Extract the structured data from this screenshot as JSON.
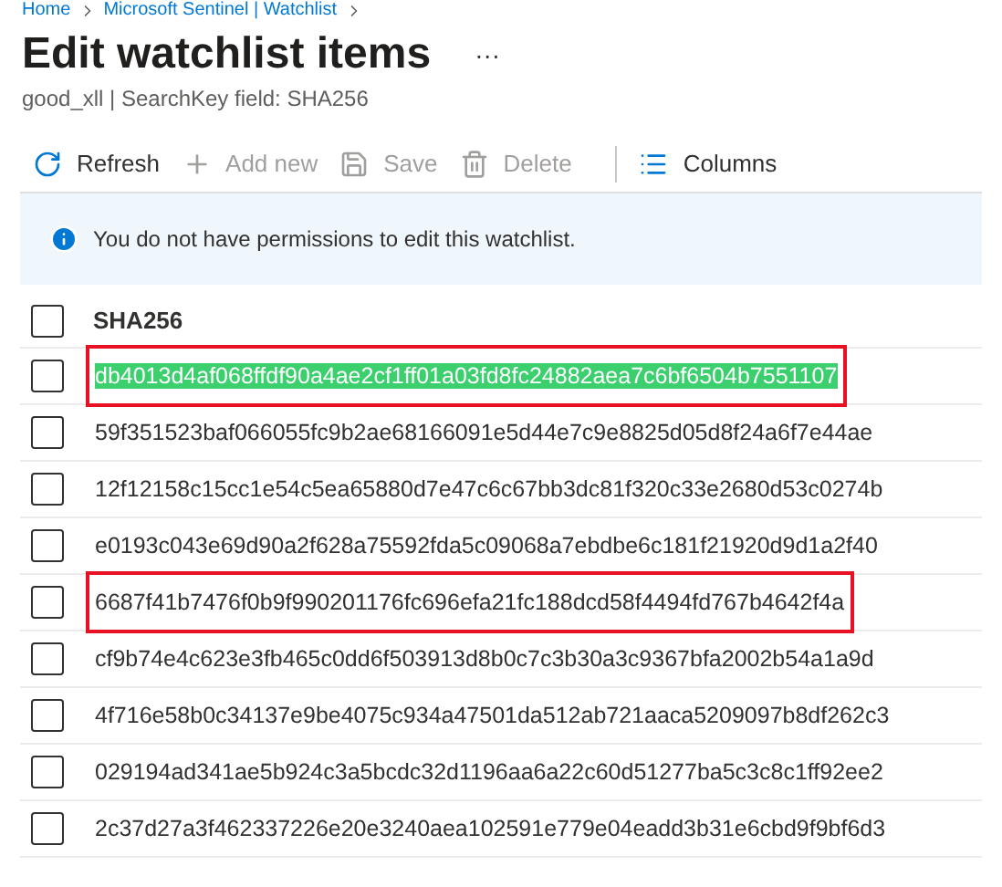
{
  "breadcrumb": [
    "Home",
    "Microsoft Sentinel | Watchlist"
  ],
  "title": "Edit watchlist items",
  "more": "···",
  "subtitle": "good_xll | SearchKey field: SHA256",
  "toolbar": [
    {
      "kind": "refresh",
      "label": "Refresh",
      "disabled": false
    },
    {
      "kind": "add",
      "label": "Add new",
      "disabled": true
    },
    {
      "kind": "save",
      "label": "Save",
      "disabled": true
    },
    {
      "kind": "delete",
      "label": "Delete",
      "disabled": true
    },
    {
      "kind": "columns",
      "label": "Columns",
      "disabled": false
    }
  ],
  "info": "You do not have permissions to edit this watchlist.",
  "table": {
    "columns": [
      "SHA256"
    ],
    "header_checked": false,
    "rows": [
      {
        "sha256": "db4013d4af068ffdf90a4ae2cf1ff01a03fd8fc24882aea7c6bf6504b7551107",
        "checked": false,
        "outlined": true,
        "highlighted": true
      },
      {
        "sha256": "59f351523baf066055fc9b2ae68166091e5d44e7c9e8825d05d8f24a6f7e44ae",
        "checked": false,
        "outlined": false,
        "highlighted": false
      },
      {
        "sha256": "12f12158c15cc1e54c5ea65880d7e47c6c67bb3dc81f320c33e2680d53c0274b",
        "checked": false,
        "outlined": false,
        "highlighted": false
      },
      {
        "sha256": "e0193c043e69d90a2f628a75592fda5c09068a7ebdbe6c181f21920d9d1a2f40",
        "checked": false,
        "outlined": false,
        "highlighted": false
      },
      {
        "sha256": "6687f41b7476f0b9f990201176fc696efa21fc188dcd58f4494fd767b4642f4a",
        "checked": false,
        "outlined": true,
        "highlighted": false
      },
      {
        "sha256": "cf9b74e4c623e3fb465c0dd6f503913d8b0c7c3b30a3c9367bfa2002b54a1a9d",
        "checked": false,
        "outlined": false,
        "highlighted": false
      },
      {
        "sha256": "4f716e58b0c34137e9be4075c934a47501da512ab721aaca5209097b8df262c3",
        "checked": false,
        "outlined": false,
        "highlighted": false
      },
      {
        "sha256": "029194ad341ae5b924c3a5bcdc32d1196aa6a22c60d51277ba5c3c8c1ff92ee2",
        "checked": false,
        "outlined": false,
        "highlighted": false
      },
      {
        "sha256": "2c37d27a3f462337226e20e3240aea102591e779e04eadd3b31e6cbd9f9bf6d3",
        "checked": false,
        "outlined": false,
        "highlighted": false
      }
    ]
  }
}
